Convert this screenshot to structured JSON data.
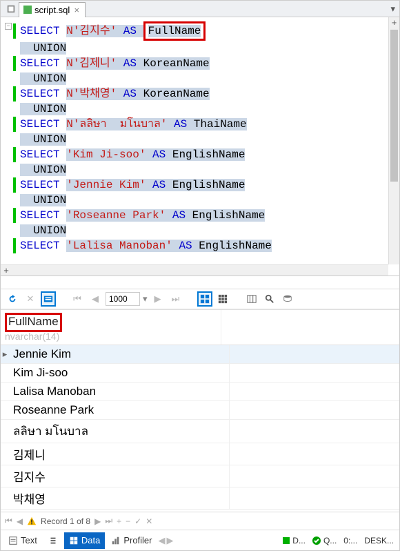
{
  "tab": {
    "filename": "script.sql",
    "close_glyph": "×"
  },
  "window": {
    "dropdown_glyph": "▾"
  },
  "editor": {
    "lines": [
      {
        "bar": true,
        "tokens": [
          [
            "kw",
            "SELECT "
          ],
          [
            "hl_str",
            "N'김지수'"
          ],
          [
            "kw_hl",
            " AS "
          ],
          [
            "red_hl",
            "FullName"
          ]
        ]
      },
      {
        "bar": false,
        "tokens": [
          [
            "hl",
            "  UNION"
          ]
        ]
      },
      {
        "bar": true,
        "tokens": [
          [
            "kw",
            "SELECT "
          ],
          [
            "hl_str",
            "N'김제니'"
          ],
          [
            "kw_hl",
            " AS "
          ],
          [
            "hl",
            "KoreanName"
          ]
        ]
      },
      {
        "bar": false,
        "tokens": [
          [
            "hl",
            "  UNION"
          ]
        ]
      },
      {
        "bar": true,
        "tokens": [
          [
            "kw",
            "SELECT "
          ],
          [
            "hl_str",
            "N'박채영'"
          ],
          [
            "kw_hl",
            " AS "
          ],
          [
            "hl",
            "KoreanName"
          ]
        ]
      },
      {
        "bar": false,
        "tokens": [
          [
            "hl",
            "  UNION"
          ]
        ]
      },
      {
        "bar": true,
        "tokens": [
          [
            "kw",
            "SELECT "
          ],
          [
            "hl_str",
            "N'ลลิษา  มโนบาล'"
          ],
          [
            "kw_hl",
            " AS "
          ],
          [
            "hl",
            "ThaiName"
          ]
        ]
      },
      {
        "bar": false,
        "tokens": [
          [
            "hl",
            "  UNION"
          ]
        ]
      },
      {
        "bar": true,
        "tokens": [
          [
            "kw",
            "SELECT "
          ],
          [
            "hl_str",
            "'Kim Ji-soo'"
          ],
          [
            "kw_hl",
            " AS "
          ],
          [
            "hl",
            "EnglishName"
          ]
        ]
      },
      {
        "bar": false,
        "tokens": [
          [
            "hl",
            "  UNION"
          ]
        ]
      },
      {
        "bar": true,
        "tokens": [
          [
            "kw",
            "SELECT "
          ],
          [
            "hl_str",
            "'Jennie Kim'"
          ],
          [
            "kw_hl",
            " AS "
          ],
          [
            "hl",
            "EnglishName"
          ]
        ]
      },
      {
        "bar": false,
        "tokens": [
          [
            "hl",
            "  UNION"
          ]
        ]
      },
      {
        "bar": true,
        "tokens": [
          [
            "kw",
            "SELECT "
          ],
          [
            "hl_str",
            "'Roseanne Park'"
          ],
          [
            "kw_hl",
            " AS "
          ],
          [
            "hl",
            "EnglishName"
          ]
        ]
      },
      {
        "bar": false,
        "tokens": [
          [
            "hl",
            "  UNION"
          ]
        ]
      },
      {
        "bar": true,
        "tokens": [
          [
            "kw",
            "SELECT "
          ],
          [
            "hl_str",
            "'Lalisa Manoban'"
          ],
          [
            "kw_hl",
            " AS "
          ],
          [
            "hl",
            "EnglishName"
          ]
        ]
      }
    ]
  },
  "results_toolbar": {
    "page_size": "1000"
  },
  "grid": {
    "column_name": "FullName",
    "column_type": "nvarchar(14)",
    "rows": [
      "Jennie Kim",
      "Kim Ji-soo",
      "Lalisa Manoban",
      "Roseanne Park",
      "ลลิษา มโนบาล",
      "김제니",
      "김지수",
      "박채영"
    ],
    "selected_index": 0
  },
  "footer_nav": {
    "label": "Record 1 of 8"
  },
  "footer_tabs": {
    "text": "Text",
    "data": "Data",
    "profiler": "Profiler"
  },
  "status": {
    "d": "D...",
    "q": "Q...",
    "timer": "0:...",
    "server": "DESK..."
  }
}
